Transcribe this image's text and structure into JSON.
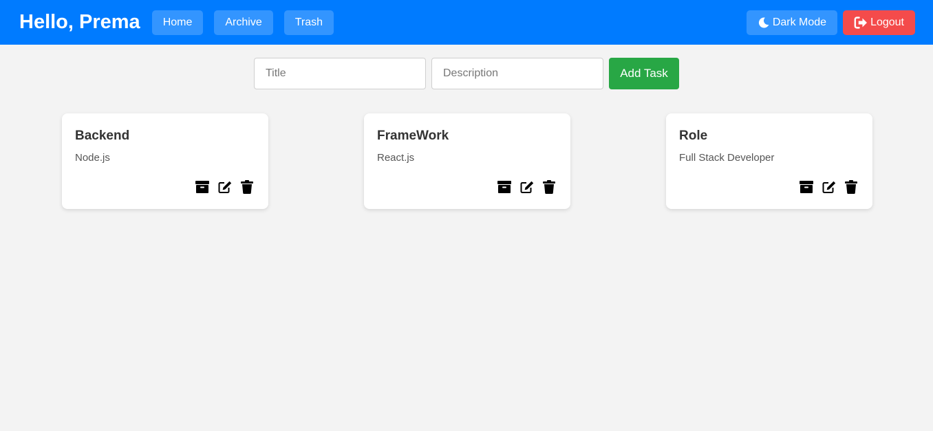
{
  "header": {
    "greeting": "Hello, Prema",
    "nav": [
      "Home",
      "Archive",
      "Trash"
    ],
    "dark_mode_label": "Dark Mode",
    "logout_label": "Logout",
    "colors": {
      "primary": "#007bff",
      "logout": "#f44b4b",
      "add": "#28a745"
    }
  },
  "form": {
    "title_placeholder": "Title",
    "description_placeholder": "Description",
    "add_label": "Add Task"
  },
  "tasks": [
    {
      "title": "Backend",
      "description": "Node.js"
    },
    {
      "title": "FrameWork",
      "description": "React.js"
    },
    {
      "title": "Role",
      "description": "Full Stack Developer"
    }
  ],
  "icons": {
    "dark_mode": "moon-icon",
    "logout": "sign-out-icon",
    "card_actions": [
      "archive-icon",
      "edit-icon",
      "trash-icon"
    ]
  }
}
